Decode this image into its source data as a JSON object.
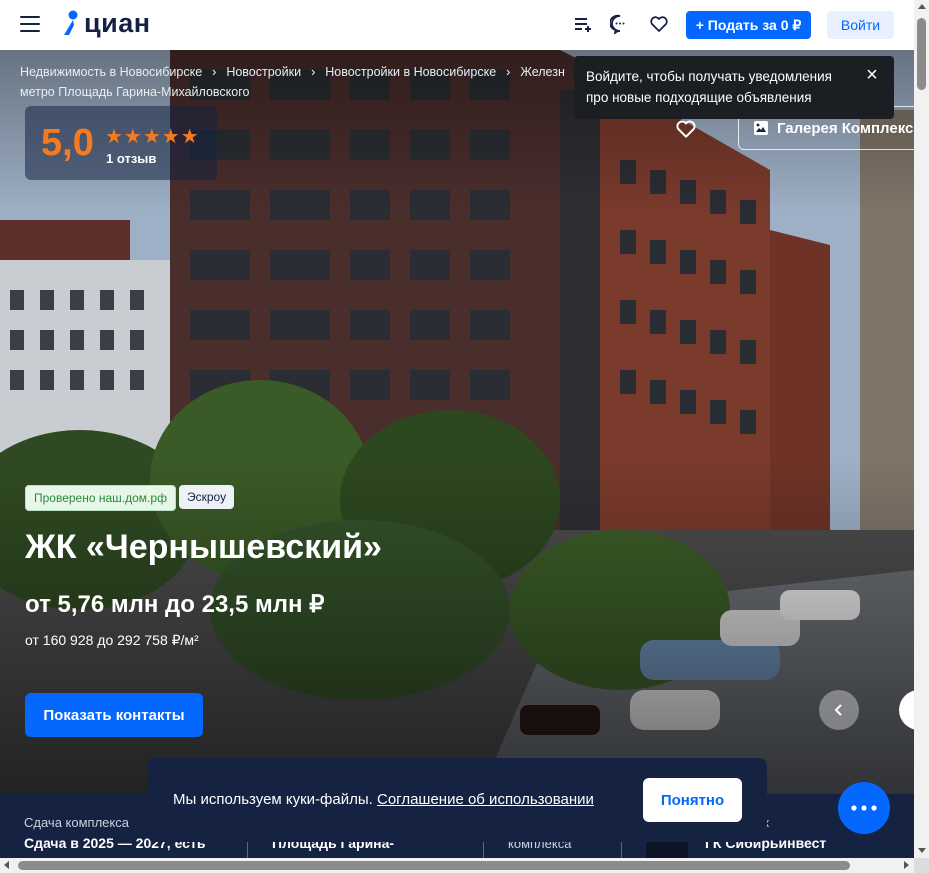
{
  "header": {
    "logo_text": "циан",
    "post_button": "+ Подать за 0 ₽",
    "login_button": "Войти"
  },
  "breadcrumbs": [
    "Недвижимость в Новосибирске",
    "Новостройки",
    "Новостройки в Новосибирске",
    "Железн"
  ],
  "breadcrumb_tail": "метро Площадь Гарина-Михайловского",
  "tooltip": {
    "text": "Войдите, чтобы получать уведомления про новые подходящие объявления"
  },
  "rating": {
    "score": "5,0",
    "stars": "★★★★★",
    "reviews": "1 отзыв"
  },
  "gallery_button": "Галерея Комплекс",
  "badges": {
    "verified": "Проверено наш.дом.рф",
    "escrow": "Эскроу"
  },
  "complex": {
    "title": "ЖК «Чернышевский»",
    "price": "от 5,76 млн до 23,5 млн ₽",
    "price_per_m2": "от 160 928 до 292 758 ₽/м²"
  },
  "contacts_button": "Показать контакты",
  "info": {
    "delivery_label": "Сдача комплекса",
    "delivery_value": "Сдача в 2025 — 2027, есть",
    "metro_value": "Площадь Гарина-",
    "class_label": "комплекса",
    "developer_label": "ик",
    "developer_value": "ГК Сибирьинвест"
  },
  "cookie": {
    "text": "Мы используем куки-файлы.",
    "link": "Соглашение об использовании",
    "button": "Понятно"
  },
  "colors": {
    "accent": "#0468ff",
    "dark": "#152242",
    "rating": "#f77b1e"
  }
}
